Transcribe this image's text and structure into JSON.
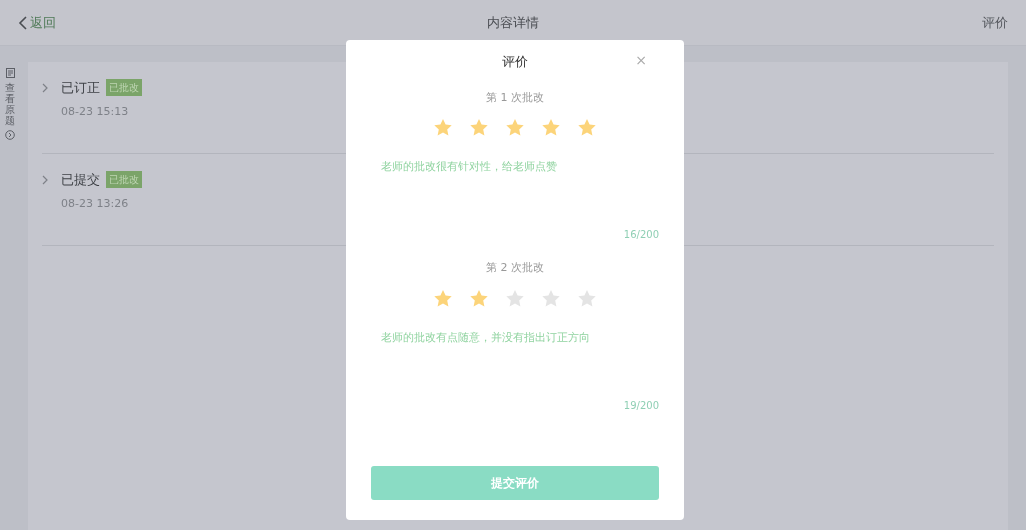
{
  "header": {
    "back": "返回",
    "title": "内容详情",
    "action": "评价"
  },
  "side_tab": {
    "label": "查看原题"
  },
  "records": [
    {
      "status": "已订正",
      "tag": "已批改",
      "time": "08-23 15:13"
    },
    {
      "status": "已提交",
      "tag": "已批改",
      "time": "08-23 13:26"
    }
  ],
  "dialog": {
    "title": "评价",
    "close": "×",
    "ratings": [
      {
        "label": "第 1 次批改",
        "stars": 5,
        "comment": "老师的批改很有针对性，给老师点赞",
        "counter": "16/200"
      },
      {
        "label": "第 2 次批改",
        "stars": 2,
        "comment": "老师的批改有点随意，并没有指出订正方向",
        "counter": "19/200"
      }
    ],
    "submit": "提交评价"
  }
}
